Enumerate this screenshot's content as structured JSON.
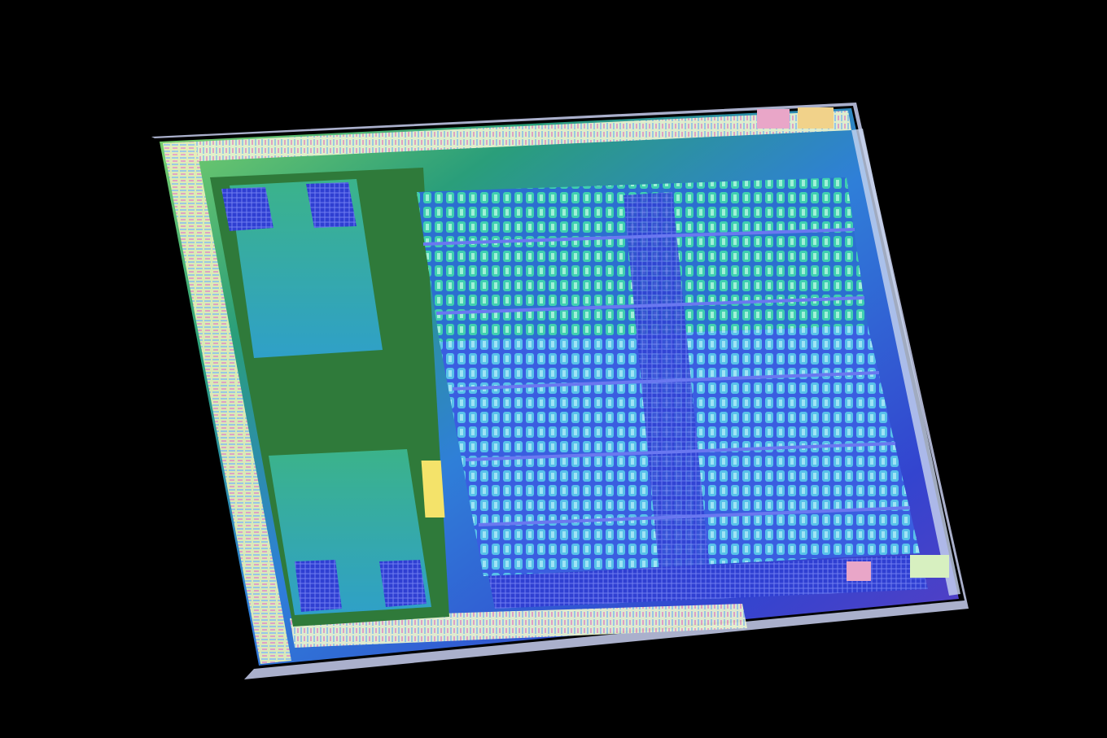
{
  "scene": {
    "subject": "semiconductor-die",
    "palette": {
      "background": "#000000",
      "edge": "#cfd3ea",
      "frame_green": "#2f7a3a",
      "io_pale": "#e8f0c8",
      "gpu_blue": "#2c3fd6",
      "compute_cyan": "#49b7e8",
      "cache_teal": "#44c9a6",
      "highlight_pink": "#e9a6c8",
      "accent_yellow": "#f4e36a"
    }
  }
}
